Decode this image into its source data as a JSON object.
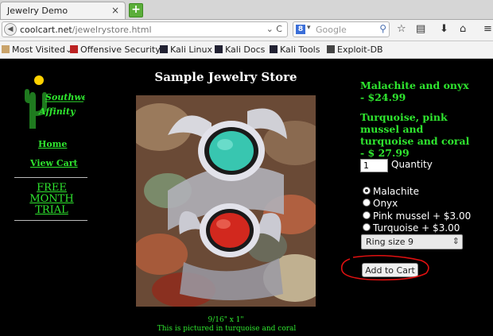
{
  "browser": {
    "tab_title": "Jewelry Demo",
    "tab_close": "×",
    "new_tab": "+",
    "url_host": "coolcart.net",
    "url_path": "/jewelrystore.html",
    "url_controls": "⌄ C",
    "search_placeholder": "Google",
    "search_engine_letter": "8",
    "bookmarks": [
      "Most Visited",
      "Offensive Security",
      "Kali Linux",
      "Kali Docs",
      "Kali Tools",
      "Exploit-DB"
    ],
    "bookmark_dropdown": "⌄"
  },
  "sidebar": {
    "home": "Home",
    "view_cart": "View Cart",
    "trial_line1": "FREE",
    "trial_line2": "MONTH",
    "trial_line3": "TRIAL"
  },
  "store": {
    "title": "Sample Jewelry Store",
    "caption_size": "9/16\" x 1\"",
    "caption_text": "This is pictured in turquoise and coral"
  },
  "product": {
    "price1_line1": "Malachite and onyx",
    "price1_line2": "- $24.99",
    "price2_line1": "Turquoise, pink",
    "price2_line2": "mussel and",
    "price2_line3": "turquoise and coral",
    "price2_line4": "- $ 27.99",
    "quantity_value": "1",
    "quantity_label": "Quantity",
    "options": [
      "Malachite",
      "Onyx",
      "Pink mussel + $3.00",
      "Turquoise + $3.00"
    ],
    "selected_option": "Malachite",
    "ring_size": "Ring size 9",
    "add_to_cart": "Add to Cart"
  },
  "colors": {
    "link_green": "#2fe62f",
    "page_bg": "#000000",
    "annotation_red": "#e01010"
  },
  "icons": [
    "search-icon",
    "bookmark-star-icon",
    "clipboard-icon",
    "download-icon",
    "home-icon",
    "menu-icon",
    "close-icon",
    "new-tab-icon",
    "reload-icon"
  ]
}
